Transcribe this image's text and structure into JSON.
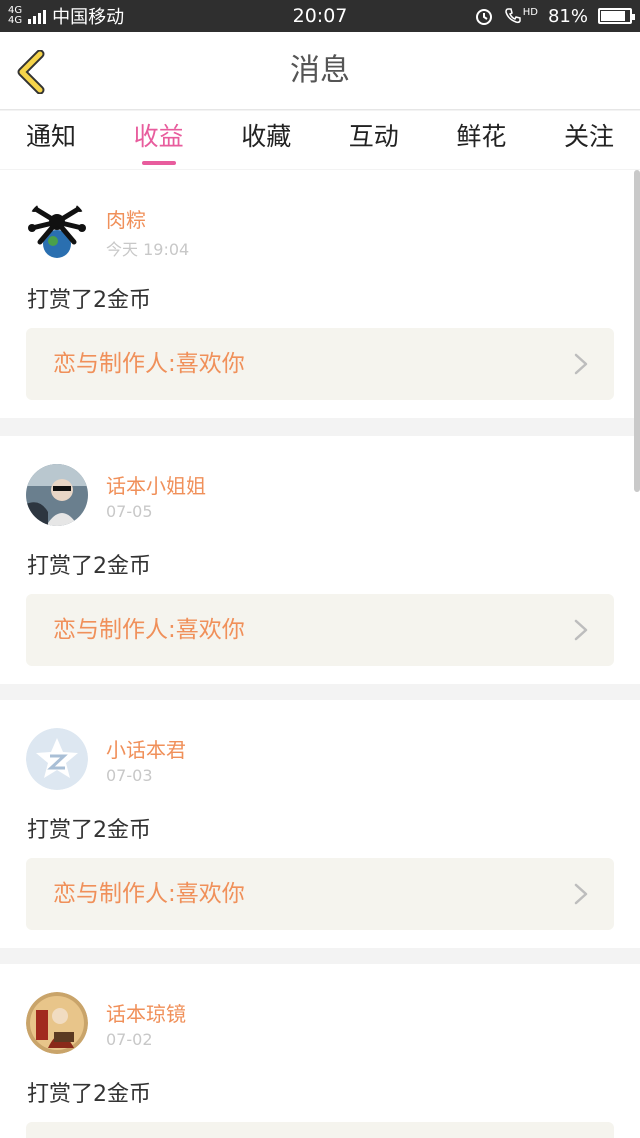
{
  "status_bar": {
    "network": "4G",
    "carrier": "中国移动",
    "time": "20:07",
    "battery_text": "81%",
    "hd_label": "HD"
  },
  "header": {
    "title": "消息"
  },
  "tabs": [
    {
      "label": "通知",
      "active": false
    },
    {
      "label": "收益",
      "active": true
    },
    {
      "label": "收藏",
      "active": false
    },
    {
      "label": "互动",
      "active": false
    },
    {
      "label": "鲜花",
      "active": false
    },
    {
      "label": "关注",
      "active": false
    }
  ],
  "items": [
    {
      "username": "肉粽",
      "time": "今天 19:04",
      "message": "打赏了2金币",
      "link": "恋与制作人:喜欢你"
    },
    {
      "username": "话本小姐姐",
      "time": "07-05",
      "message": "打赏了2金币",
      "link": "恋与制作人:喜欢你"
    },
    {
      "username": "小话本君",
      "time": "07-03",
      "message": "打赏了2金币",
      "link": "恋与制作人:喜欢你"
    },
    {
      "username": "话本琼镜",
      "time": "07-02",
      "message": "打赏了2金币",
      "link": ""
    }
  ],
  "colors": {
    "accent": "#e85c9d",
    "username": "#f0905a",
    "status_bar": "#2f2f2f"
  }
}
